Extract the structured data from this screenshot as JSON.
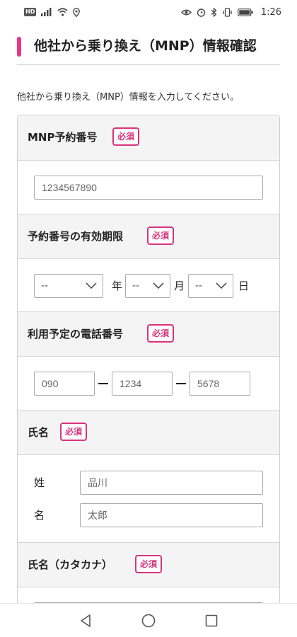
{
  "status_bar": {
    "hd": "HD",
    "time": "1:26"
  },
  "header": {
    "title": "他社から乗り換え（MNP）情報確認"
  },
  "intro": "他社から乗り換え（MNP）情報を入力してください。",
  "required_badge": "必須",
  "sections": {
    "mnp_number": {
      "label": "MNP予約番号",
      "placeholder": "1234567890"
    },
    "expiry": {
      "label": "予約番号の有効期限",
      "year_value": "--",
      "year_unit": "年",
      "month_value": "--",
      "month_unit": "月",
      "day_value": "--",
      "day_unit": "日"
    },
    "phone": {
      "label": "利用予定の電話番号",
      "part1": "090",
      "part2": "1234",
      "part3": "5678"
    },
    "name": {
      "label": "氏名",
      "sei_label": "姓",
      "sei_placeholder": "品川",
      "mei_label": "名",
      "mei_placeholder": "太郎"
    },
    "kana": {
      "label": "氏名（カタカナ）"
    }
  },
  "colors": {
    "accent": "#e8358c",
    "required": "#d8337c",
    "section_bg": "#f4f4f4"
  }
}
